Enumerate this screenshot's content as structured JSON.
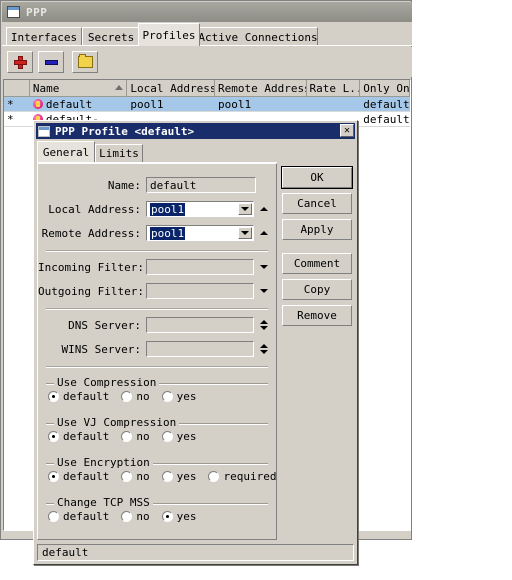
{
  "main_window": {
    "title": "PPP",
    "icon": "window-icon",
    "tabs": [
      {
        "label": "Interfaces",
        "active": false
      },
      {
        "label": "Secrets",
        "active": false
      },
      {
        "label": "Profiles",
        "active": true
      },
      {
        "label": "Active Connections",
        "active": false
      }
    ],
    "toolbar": [
      {
        "name": "add-button",
        "icon": "plus-icon"
      },
      {
        "name": "remove-button",
        "icon": "minus-icon"
      },
      {
        "name": "comment-button",
        "icon": "folder-icon"
      }
    ],
    "table": {
      "columns": [
        "Name",
        "Local Address",
        "Remote Address",
        "Rate L...",
        "Only One"
      ],
      "sorted_column": "Name",
      "rows": [
        {
          "flag": "*",
          "icon": "profile-icon",
          "name": "default",
          "local_address": "pool1",
          "remote_address": "pool1",
          "rate_limit": "",
          "only_one": "default",
          "selected": true
        },
        {
          "flag": "*",
          "icon": "profile-icon",
          "name": "default-",
          "local_address": "",
          "remote_address": "",
          "rate_limit": "",
          "only_one": "default",
          "selected": false
        }
      ]
    }
  },
  "dialog": {
    "title": "PPP Profile <default>",
    "close_label": "✕",
    "tabs": [
      {
        "label": "General",
        "active": true
      },
      {
        "label": "Limits",
        "active": false
      }
    ],
    "fields": {
      "name": {
        "label": "Name:",
        "value": "default"
      },
      "local_address": {
        "label": "Local Address:",
        "value": "pool1"
      },
      "remote_address": {
        "label": "Remote Address:",
        "value": "pool1"
      },
      "incoming_filter": {
        "label": "Incoming Filter:",
        "value": ""
      },
      "outgoing_filter": {
        "label": "Outgoing Filter:",
        "value": ""
      },
      "dns_server": {
        "label": "DNS Server:",
        "value": ""
      },
      "wins_server": {
        "label": "WINS Server:",
        "value": ""
      }
    },
    "groups": [
      {
        "title": "Use Compression",
        "options": [
          {
            "label": "default",
            "selected": true
          },
          {
            "label": "no",
            "selected": false
          },
          {
            "label": "yes",
            "selected": false
          }
        ]
      },
      {
        "title": "Use VJ Compression",
        "options": [
          {
            "label": "default",
            "selected": true
          },
          {
            "label": "no",
            "selected": false
          },
          {
            "label": "yes",
            "selected": false
          }
        ]
      },
      {
        "title": "Use Encryption",
        "options": [
          {
            "label": "default",
            "selected": true
          },
          {
            "label": "no",
            "selected": false
          },
          {
            "label": "yes",
            "selected": false
          },
          {
            "label": "required",
            "selected": false
          }
        ]
      },
      {
        "title": "Change TCP MSS",
        "options": [
          {
            "label": "default",
            "selected": false
          },
          {
            "label": "no",
            "selected": false
          },
          {
            "label": "yes",
            "selected": true
          }
        ]
      }
    ],
    "buttons": [
      {
        "label": "OK",
        "default": true
      },
      {
        "label": "Cancel",
        "default": false
      },
      {
        "label": "Apply",
        "default": false
      },
      {
        "label": "Comment",
        "default": false
      },
      {
        "label": "Copy",
        "default": false
      },
      {
        "label": "Remove",
        "default": false
      }
    ],
    "status": "default"
  },
  "colors": {
    "face": "#d4d0c8",
    "dialog_titlebar": "#1a2d6b",
    "main_titlebar": "#9a9a93",
    "row_selected": "#a6c8e8",
    "text_selection": "#0a246a",
    "add_icon": "#cc2222",
    "remove_icon": "#2222bb",
    "folder_icon": "#f2d24a",
    "profile_icon": "#e0237a"
  }
}
